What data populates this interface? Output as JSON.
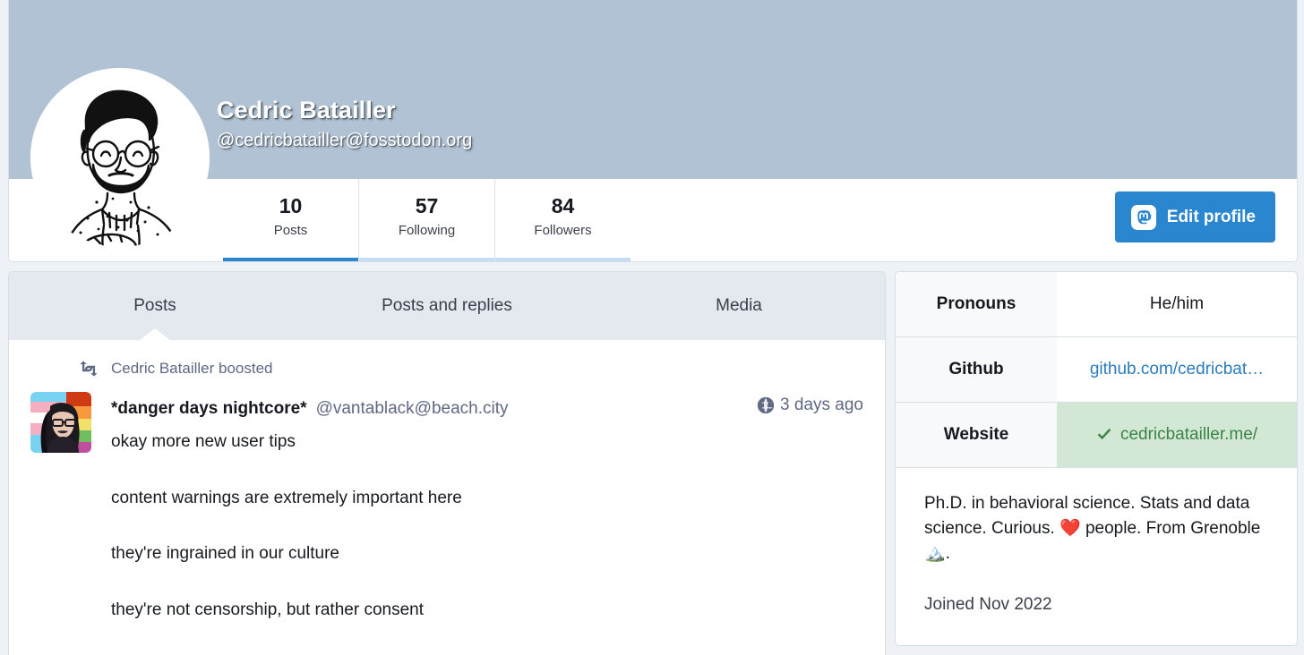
{
  "profile": {
    "display_name": "Cedric Batailler",
    "handle": "@cedricbatailler@fosstodon.org",
    "avatar_name": "cedric-batailler-avatar",
    "banner_color": "#b0c2d4",
    "accent_color": "#2b86d0",
    "counters": [
      {
        "value": "10",
        "label": "Posts",
        "active": true
      },
      {
        "value": "57",
        "label": "Following",
        "active": false
      },
      {
        "value": "84",
        "label": "Followers",
        "active": false
      }
    ],
    "edit_button": {
      "label": "Edit profile",
      "icon": "mastodon-icon"
    }
  },
  "tabs": [
    {
      "label": "Posts",
      "selected": true
    },
    {
      "label": "Posts and replies",
      "selected": false
    },
    {
      "label": "Media",
      "selected": false
    }
  ],
  "timeline": {
    "boost": {
      "icon": "boost-icon",
      "text": "Cedric Batailler boosted"
    },
    "post": {
      "avatar_name": "vantablack-avatar",
      "author": "*danger days nightcore*",
      "handle": "@vantablack@beach.city",
      "visibility_icon": "globe-icon",
      "timestamp": "3 days ago",
      "paragraphs": [
        "okay more new user tips",
        "content warnings are extremely important here",
        "they're ingrained in our culture",
        "they're not censorship, but rather consent"
      ]
    }
  },
  "sidebar": {
    "fields": [
      {
        "label": "Pronouns",
        "value": "He/him",
        "style": "plain",
        "verified": false
      },
      {
        "label": "Github",
        "value": "github.com/cedricbat…",
        "style": "link",
        "verified": false
      },
      {
        "label": "Website",
        "value": "cedricbatailler.me/",
        "style": "verified",
        "verified": true,
        "verified_color": "#3c8448",
        "verified_bg": "#d3e7d5"
      }
    ],
    "bio": {
      "part1": "Ph.D. in behavioral science. Stats and data science. Curious.",
      "heart_emoji": "❤️",
      "part2": "people. From Grenoble",
      "mountain_emoji": "🏔️",
      "part3": "."
    },
    "joined": "Joined Nov 2022"
  }
}
